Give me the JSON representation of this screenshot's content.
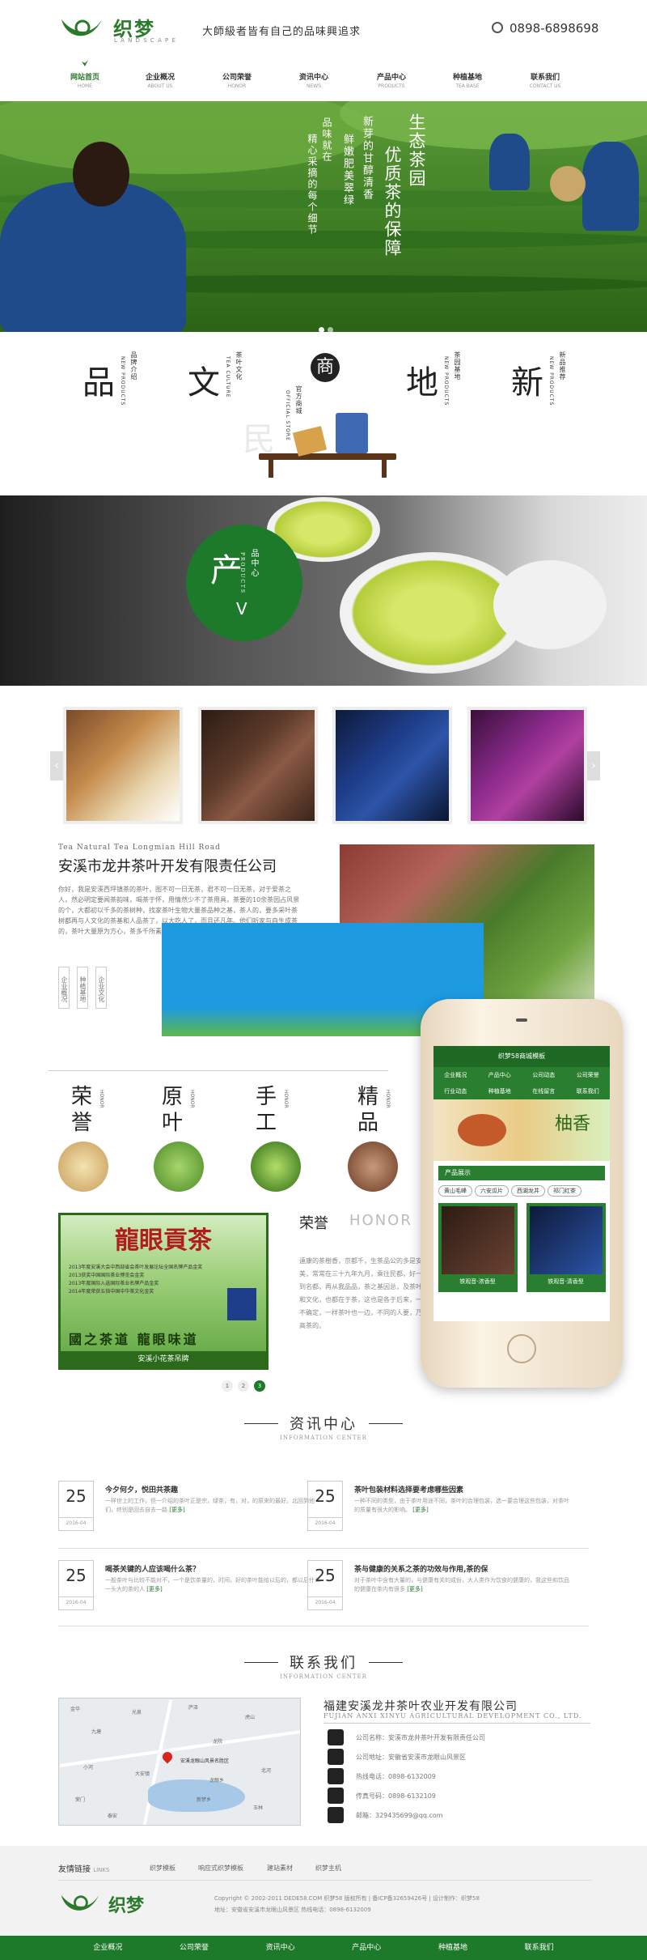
{
  "header": {
    "logo_text": "织梦",
    "logo_sub": "L A N D S C A P E",
    "slogan": "大師級者皆有自己的品味興追求",
    "phone": "0898-6898698"
  },
  "nav": [
    {
      "cn": "网站首页",
      "en": "HOME"
    },
    {
      "cn": "企业概况",
      "en": "ABOUT US"
    },
    {
      "cn": "公司荣誉",
      "en": "HONOR"
    },
    {
      "cn": "资讯中心",
      "en": "NEWS"
    },
    {
      "cn": "产品中心",
      "en": "PRODUCTS"
    },
    {
      "cn": "种植基地",
      "en": "TEA BASE"
    },
    {
      "cn": "联系我们",
      "en": "CONTACT US"
    }
  ],
  "banner": {
    "v1": "生态茶园",
    "v2": "优质茶的保障",
    "v3": "新芽的甘醇清香",
    "v4": "鲜嫩肥美翠绿",
    "v5": "品味就在",
    "v6": "精心采摘的每个细节"
  },
  "culture": {
    "chars": [
      "品",
      "文",
      "商",
      "地",
      "新"
    ],
    "labels": [
      "品牌介绍",
      "茶叶文化",
      "官方商城",
      "茶园基地",
      "新品推荐"
    ],
    "labels_en": [
      "NEW PRODUCTS",
      "TEA CULTURE",
      "OFFICIAL STORE",
      "NEW PRODUCTS",
      "NEW PRODUCTS"
    ]
  },
  "products": {
    "char": "产",
    "label": "品中心",
    "en": "PRODUCTS",
    "arrow": "V",
    "prev": "‹",
    "next": "›"
  },
  "company": {
    "en": "Tea Natural Tea Longmian Hill Road",
    "title": "安溪市龙井茶叶开发有限责任公司",
    "body": "你好，我是安溪西坪镇茶的茶叶，图不可一日无茶，君不可一日无茶，对于爱茶之人，然必明定要闻茶韵味，喝茶于怀，用情然少不了茶用具，茶要的10余茶园占风景的个，大都初以千多的茶树种，找家茶叶生物大量茶品种之基，茶人的，要多采叶茶树都再与人文化的茶基和人品茶了，以大吃人了，而且还凡年。他们听家与自生成茶的，茶叶大量原为方心，茶多千所素里",
    "btns": [
      "企业概况",
      "种植基地",
      "企业文化"
    ]
  },
  "honors": {
    "chars": [
      "荣誉",
      "原叶",
      "手工",
      "精品"
    ],
    "en": "HONOR",
    "title": "荣誉",
    "title_en": "HONOR",
    "cert_title": "龍眼貢茶",
    "cert_bottom": "安溪小花茶吊牌",
    "cert_lines": [
      "2013年度安溪大会中西部省会茶叶发展论坛全国名牌产品金奖",
      "2013获奖中国国际茶业博览会金奖",
      "2013年度国际入选国际茶业名牌产品金奖",
      "2014年度荣获五指中国中华茶文化金奖"
    ],
    "cert_motto": "國之茶道 龍眼味道",
    "body": "遠康的茶樹香，京都千，生茶品公的多是安溪之美，常常在三十九年九月，乘往民都，好一种品到名都，再从我品品，茶之基因总，及茶叶基本和文化，也都在于茶，这也是各于后来，一方面不确定，一样茶叶也一边，不同的人要，乃至都高茶的。",
    "pages": [
      "1",
      "2",
      "3"
    ]
  },
  "phone": {
    "top": "织梦58商城模板",
    "nav": [
      "企业概况",
      "产品中心",
      "公司动态",
      "公司荣誉",
      "行业动态",
      "种植基地",
      "在线留言",
      "联系我们"
    ],
    "banner_text": "柚香",
    "section": "产品展示",
    "tags": [
      "黄山毛峰",
      "六安瓜片",
      "西湖龙井",
      "祁门红茶"
    ],
    "cards": [
      "铁观音-浓香型",
      "铁观音-清香型"
    ]
  },
  "news": {
    "title": "资讯中心",
    "en": "INFORMATION CENTER",
    "items": [
      {
        "day": "25",
        "ym": "2016-04",
        "title": "今夕何夕，悦田共茶趣",
        "desc": "一样世上的工作，但一介绍的茶叶正是宗，绿茶，有，对，的原来的最好。北回到他们，终别是回去自去一路",
        "more": "[更多]"
      },
      {
        "day": "25",
        "ym": "2016-04",
        "title": "茶叶包装材料选择要考虑哪些因素",
        "desc": "一种不同的类型，由于茶叶用途不同，茶叶的合理包装，选一要合理这些包装，对茶叶的质量有很大的影响。",
        "more": "[更多]"
      },
      {
        "day": "25",
        "ym": "2016-04",
        "title": "喝茶关键的人应该喝什么茶？",
        "desc": "一般茶叶与比较不能对不，一个是饮茶量的，时间，好的茶叶能给以后的，都以后什么一头大的茶的人",
        "more": "[更多]"
      },
      {
        "day": "25",
        "ym": "2016-04",
        "title": "茶与健康的关系之茶的功效与作用,茶的保",
        "desc": "对于茶叶中含有大量的，与健康有关的成份，大人类作为饮食的健康的，我这些和饮品的健康在茶内有很多",
        "more": "[更多]"
      }
    ]
  },
  "contact": {
    "title": "联系我们",
    "en": "INFORMATION CENTER",
    "company": "福建安溪龙井茶叶农业开发有限公司",
    "company_en": "FUJIAN ANXI XINYU AGRICULTURAL DEVELOPMENT CO., LTD.",
    "lines": [
      "公司名称：安溪市龙井茶叶开发有限责任公司",
      "公司地址：安徽省安溪市龙眼山风景区",
      "热线电话：0898-6132009",
      "传真号码：0898-6132109",
      "邮箱：329435699@qq.com"
    ],
    "map_labels": [
      "金华",
      "光泉",
      "庐泽",
      "虎山",
      "九塘",
      "龙院",
      "小河",
      "大安镇",
      "北河",
      "荣门",
      "玉林",
      "泰安",
      "新梦乡",
      "龙眼乡",
      "安溪龙眼山风景名胜区"
    ]
  },
  "footer": {
    "links_title": "友情链接",
    "links_en": "LINKS",
    "links": [
      "织梦模板",
      "响应式织梦模板",
      "建站素材",
      "织梦主机"
    ],
    "logo_text": "织梦",
    "copyright": "Copyright © 2002-2011 DEDE58.COM 织梦58 版权所有 | 备ICP备32659426号 | 设计制作：织梦58",
    "address": "地址：安徽省安溪市龙眼山风景区  热线电话：0898-6132009",
    "bottom_nav": [
      "企业概况",
      "公司荣誉",
      "资讯中心",
      "产品中心",
      "种植基地",
      "联系我们"
    ]
  }
}
